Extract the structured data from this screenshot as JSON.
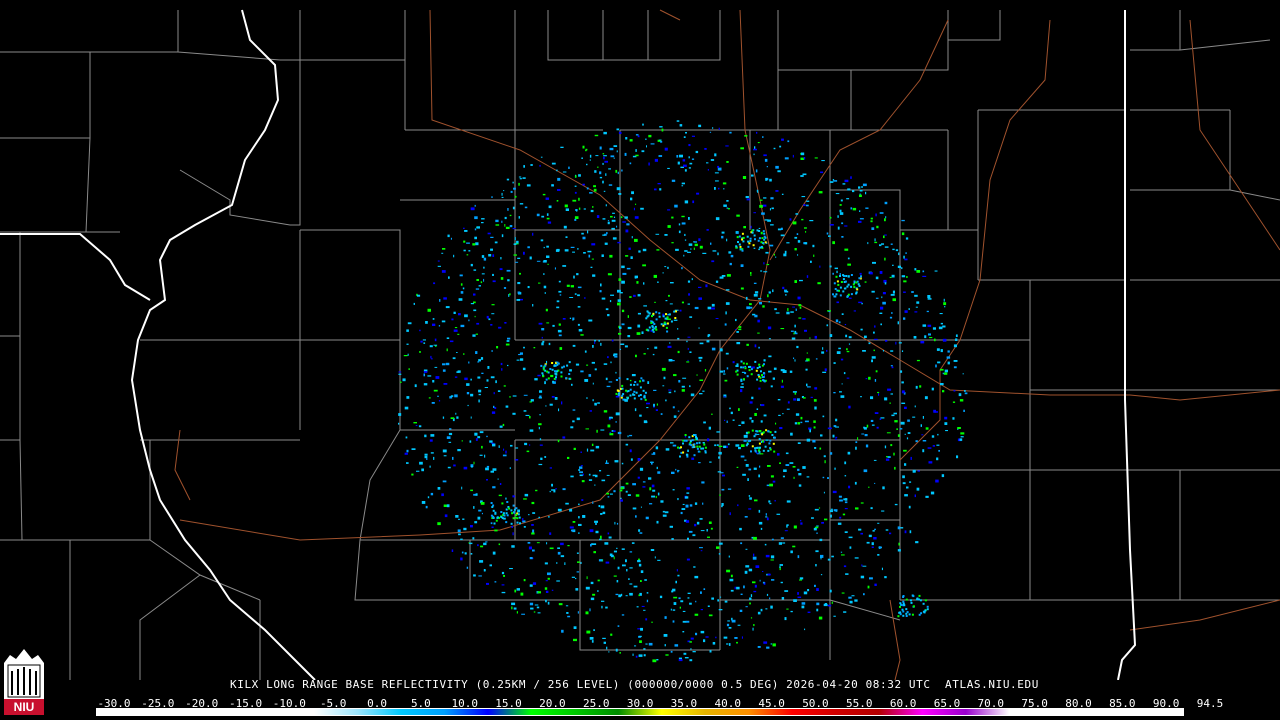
{
  "caption": "KILX LONG RANGE BASE REFLECTIVITY (0.25KM / 256 LEVEL) (000000/0000 0.5 DEG) 2026-04-20 08:32 UTC  ATLAS.NIU.EDU",
  "logo": {
    "icon": "niu-logo-icon",
    "text": "NIU",
    "colors": {
      "red": "#c8102e",
      "white": "#ffffff"
    }
  },
  "scale": {
    "labels": [
      "-30.0",
      "-25.0",
      "-20.0",
      "-15.0",
      "-10.0",
      "-5.0",
      "0.0",
      "5.0",
      "10.0",
      "15.0",
      "20.0",
      "25.0",
      "30.0",
      "35.0",
      "40.0",
      "45.0",
      "50.0",
      "55.0",
      "60.0",
      "65.0",
      "70.0",
      "75.0",
      "80.0",
      "85.0",
      "90.0",
      "94.5"
    ],
    "colors": [
      "#ffffff",
      "#ffffff",
      "#ffffff",
      "#ffffff",
      "#ffffff",
      "#ffffff",
      "#9ce6ff",
      "#00c8ff",
      "#00a0ff",
      "#0000ff",
      "#00ff00",
      "#00c800",
      "#008c00",
      "#ffff00",
      "#e6b400",
      "#ff9000",
      "#ff0000",
      "#d00000",
      "#b40000",
      "#ff00ff",
      "#9900cc",
      "#ffffff",
      "#ffffff",
      "#ffffff",
      "#ffffff",
      "#ffffff"
    ]
  },
  "map_colors": {
    "background": "#000000",
    "county_lines": "#8a8a8a",
    "state_lines": "#ffffff",
    "rivers": "#a0522d",
    "echo_light": "#00c8ff",
    "echo_mid": "#00a0ff",
    "echo_dark": "#0000ff",
    "echo_green": "#00ff00",
    "echo_yellow": "#ffff00"
  }
}
